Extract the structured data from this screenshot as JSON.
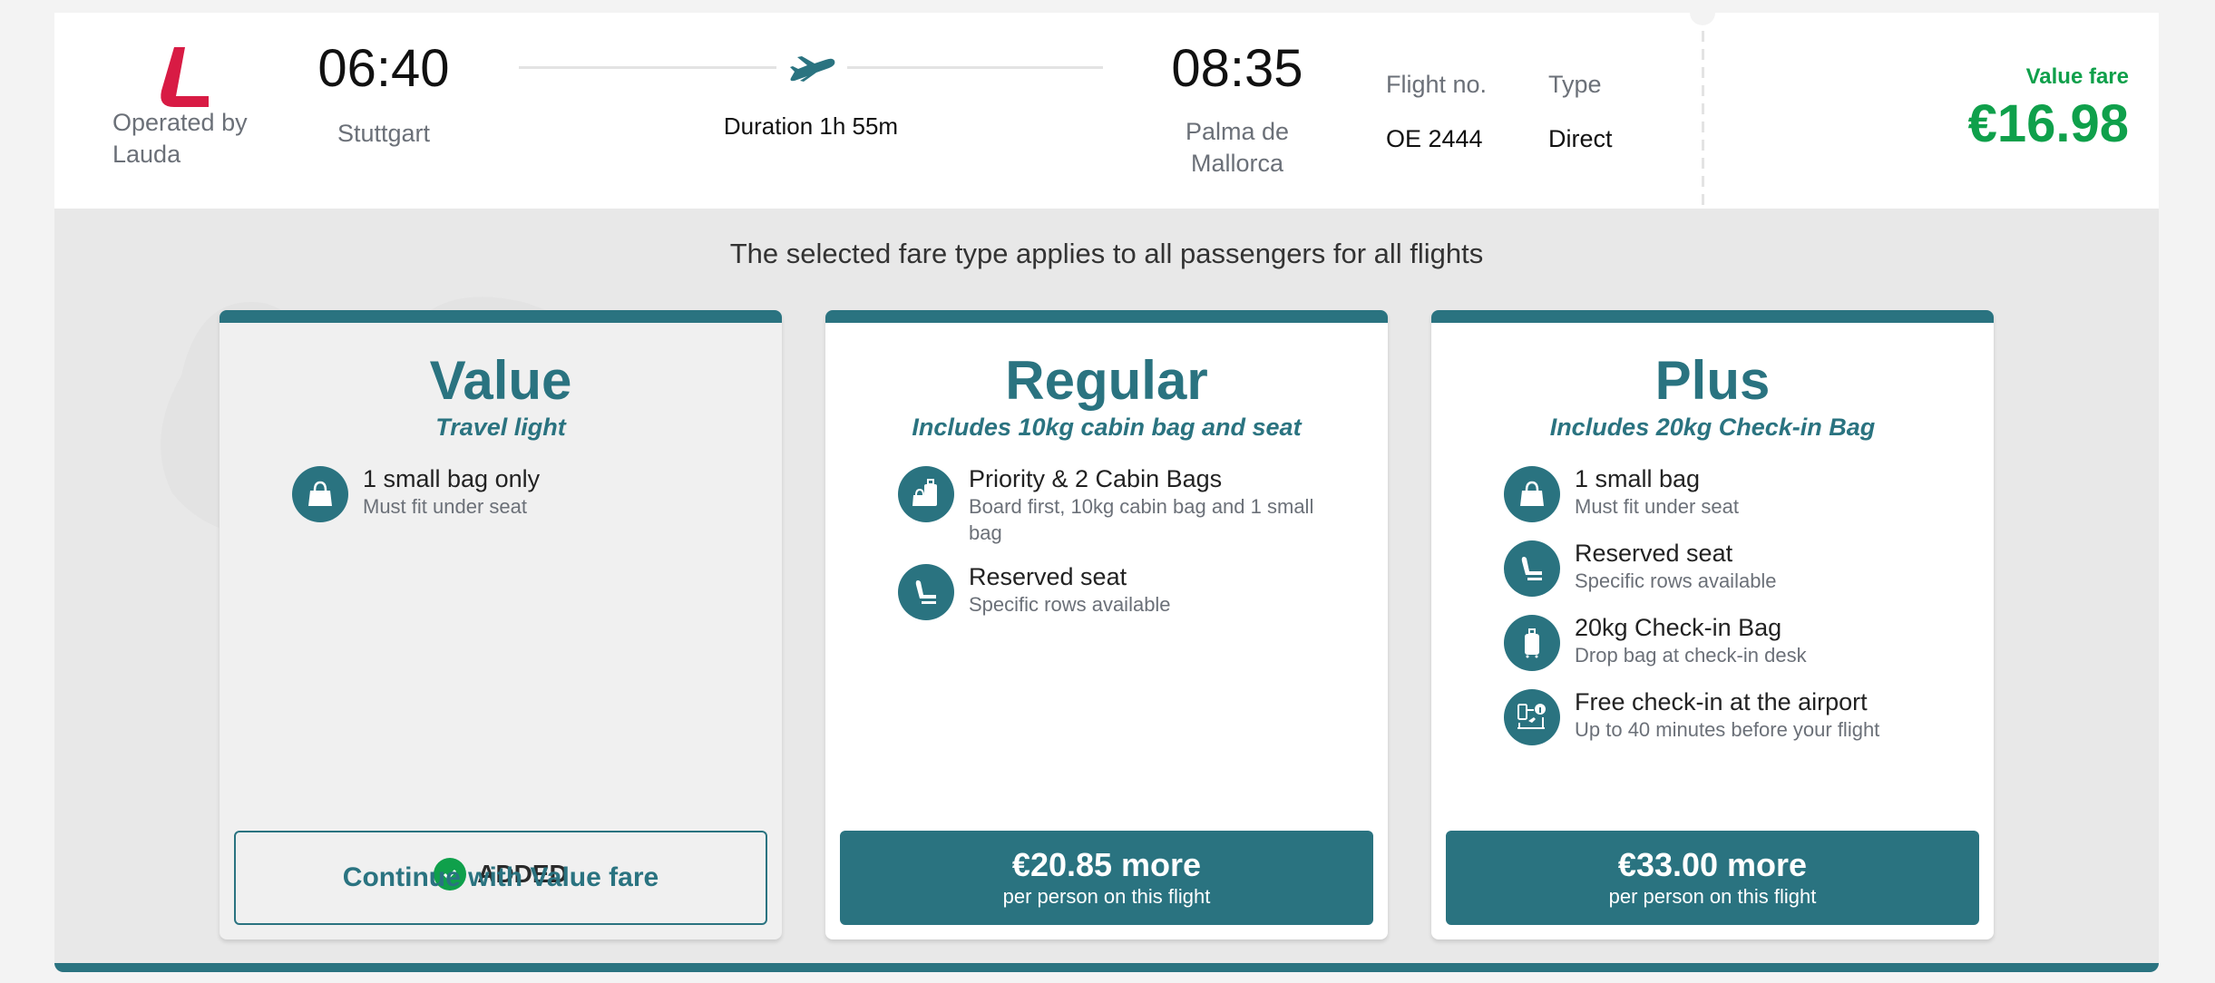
{
  "header": {
    "operated_by": "Operated by Lauda",
    "airline_logo": "lauda-logo",
    "departure": {
      "time": "06:40",
      "city": "Stuttgart"
    },
    "duration": "Duration 1h 55m",
    "arrival": {
      "time": "08:35",
      "city": "Palma de Mallorca"
    },
    "flight_no_label": "Flight no.",
    "flight_no": "OE 2444",
    "type_label": "Type",
    "type": "Direct",
    "fare_label": "Value fare",
    "fare_price": "€16.98"
  },
  "subtitle": "The selected fare type applies to all passengers for all flights",
  "colors": {
    "brand": "#2a7380",
    "price_green": "#0fa04b",
    "logo_red": "#d81b44"
  },
  "fares": [
    {
      "name": "Value",
      "tagline": "Travel light",
      "selected": true,
      "features": [
        {
          "icon": "handbag-icon",
          "title": "1 small bag only",
          "desc": "Must fit under seat"
        }
      ],
      "status": "ADDED",
      "button": {
        "label": "Continue with Value fare"
      }
    },
    {
      "name": "Regular",
      "tagline": "Includes 10kg cabin bag and seat",
      "selected": false,
      "features": [
        {
          "icon": "cabin-bags-icon",
          "title": "Priority & 2 Cabin Bags",
          "desc": "Board first, 10kg cabin bag and 1 small bag"
        },
        {
          "icon": "seat-icon",
          "title": "Reserved seat",
          "desc": "Specific rows available"
        }
      ],
      "button": {
        "label": "€20.85 more",
        "sub": "per person on this flight"
      }
    },
    {
      "name": "Plus",
      "tagline": "Includes 20kg Check-in Bag",
      "selected": false,
      "features": [
        {
          "icon": "handbag-icon",
          "title": "1 small bag",
          "desc": "Must fit under seat"
        },
        {
          "icon": "seat-icon",
          "title": "Reserved seat",
          "desc": "Specific rows available"
        },
        {
          "icon": "suitcase-icon",
          "title": "20kg Check-in Bag",
          "desc": "Drop bag at check-in desk"
        },
        {
          "icon": "checkin-desk-icon",
          "title": "Free check-in at the airport",
          "desc": "Up to 40 minutes before your flight"
        }
      ],
      "button": {
        "label": "€33.00 more",
        "sub": "per person on this flight"
      }
    }
  ]
}
